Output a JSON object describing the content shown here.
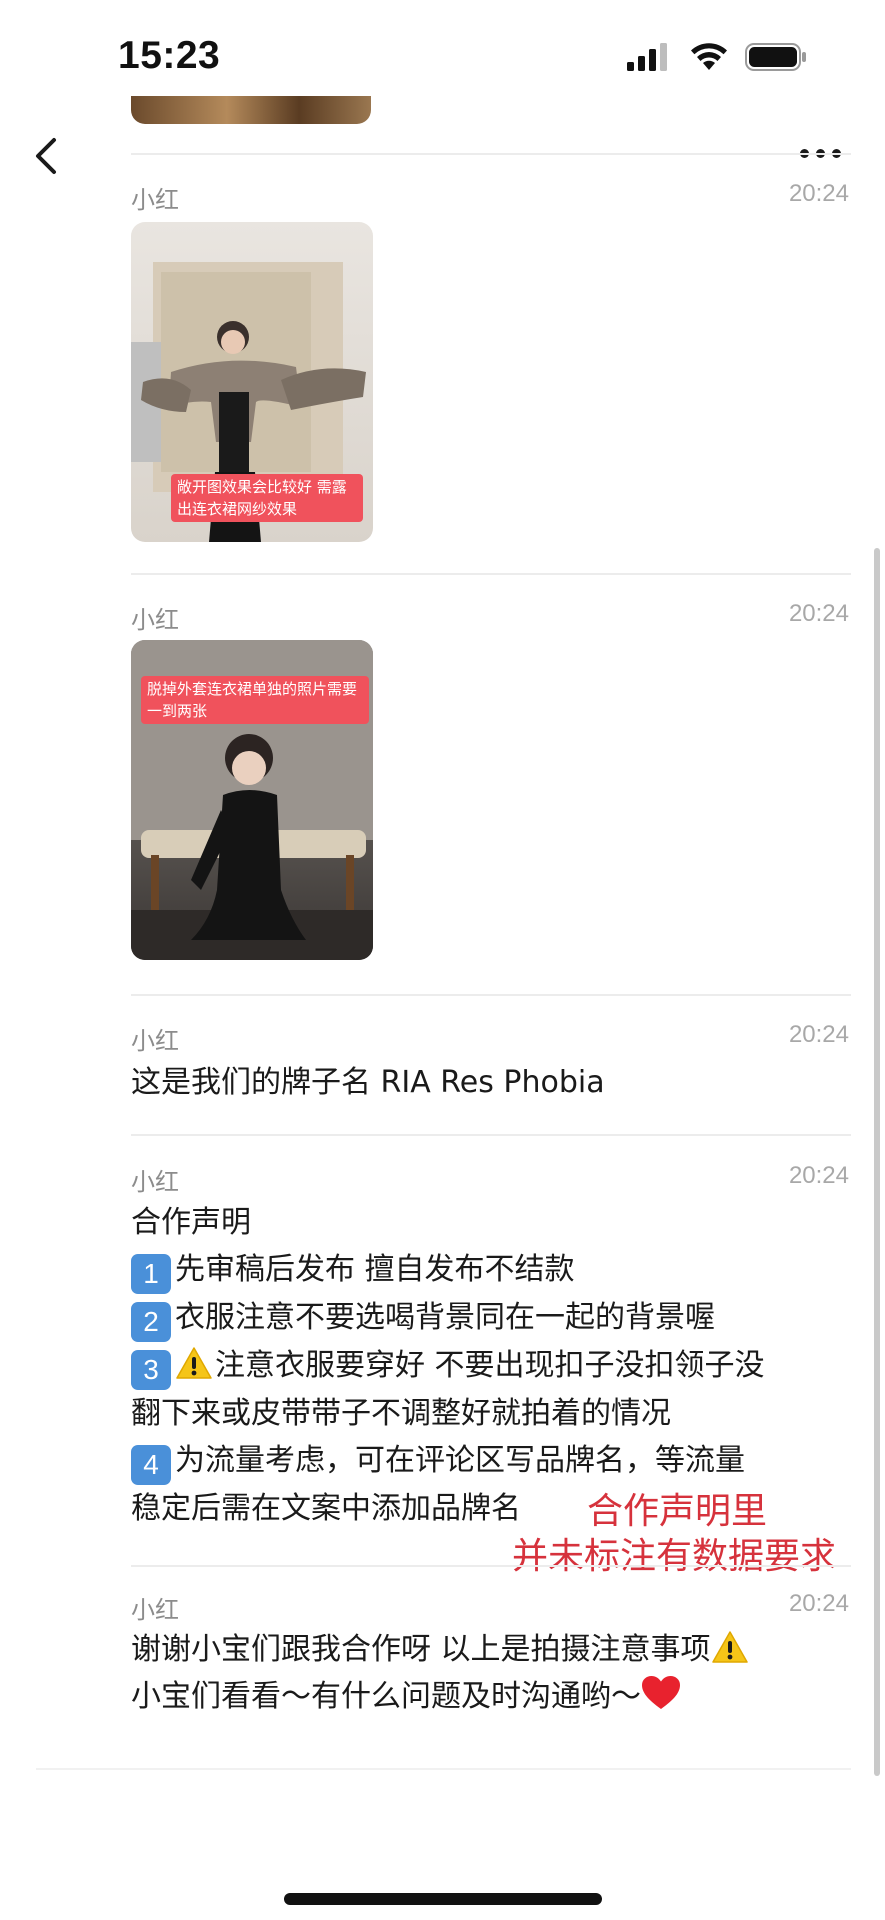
{
  "status_bar": {
    "time": "15:23"
  },
  "nav": {
    "back_icon": "chevron-left-icon",
    "more_icon": "ellipsis-icon"
  },
  "messages": [
    {
      "sender": "小红",
      "time": "20:24",
      "type": "image",
      "caption": "敞开图效果会比较好 需露出连衣裙网纱效果"
    },
    {
      "sender": "小红",
      "time": "20:24",
      "type": "image",
      "caption": "脱掉外套连衣裙单独的照片需要一到两张"
    },
    {
      "sender": "小红",
      "time": "20:24",
      "type": "text",
      "lines": [
        "这是我们的牌子名 RIA Res Phobia"
      ]
    },
    {
      "sender": "小红",
      "time": "20:24",
      "type": "text",
      "lines": [
        "合作声明",
        "先审稿后发布 擅自发布不结款",
        "衣服注意不要选喝背景同在一起的背景喔",
        "注意衣服要穿好 不要出现扣子没扣领子没",
        "翻下来或皮带带子不调整好就拍着的情况",
        "为流量考虑，可在评论区写品牌名，等流量",
        "稳定后需在文案中添加品牌名"
      ],
      "badges": [
        "1",
        "2",
        "3",
        "4"
      ]
    },
    {
      "sender": "小红",
      "time": "20:24",
      "type": "text",
      "lines": [
        "谢谢小宝们跟我合作呀  以上是拍摄注意事项",
        " 小宝们看看～有什么问题及时沟通哟～"
      ]
    }
  ],
  "annotation": {
    "line1": "合作声明里",
    "line2": "并未标注有数据要求",
    "color": "#d6323c"
  },
  "colors": {
    "badge": "#4a90d9",
    "caption_bg": "#f0525c",
    "warning": "#f5c518",
    "heart": "#e8222e"
  }
}
